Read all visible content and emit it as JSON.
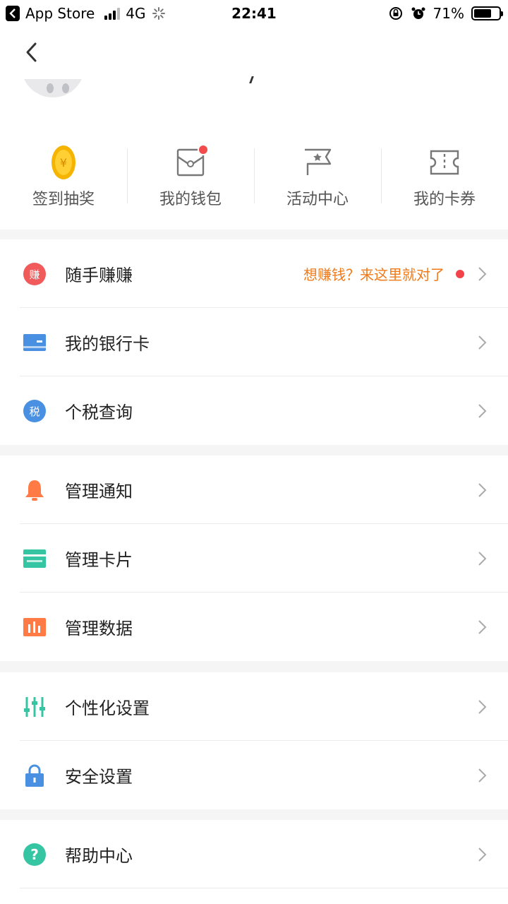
{
  "status_bar": {
    "back_app": "App Store",
    "network": "4G",
    "time": "22:41",
    "battery": "71%",
    "battery_level": 0.71
  },
  "quick_actions": [
    {
      "label": "签到抽奖",
      "icon": "coin-icon",
      "badge": false
    },
    {
      "label": "我的钱包",
      "icon": "wallet-icon",
      "badge": true
    },
    {
      "label": "活动中心",
      "icon": "flag-icon",
      "badge": false
    },
    {
      "label": "我的卡券",
      "icon": "ticket-icon",
      "badge": false
    }
  ],
  "groups": [
    {
      "items": [
        {
          "label": "随手赚赚",
          "icon": "earn-icon",
          "icon_text": "赚",
          "hint": "想赚钱？来这里就对了",
          "color": "#f05a5a"
        },
        {
          "label": "我的银行卡",
          "icon": "bank-card-icon",
          "color": "#4a90e2"
        },
        {
          "label": "个税查询",
          "icon": "tax-icon",
          "icon_text": "税",
          "color": "#4a90e2"
        }
      ]
    },
    {
      "items": [
        {
          "label": "管理通知",
          "icon": "bell-icon",
          "color": "#ff7a45"
        },
        {
          "label": "管理卡片",
          "icon": "cards-icon",
          "color": "#36c5a3"
        },
        {
          "label": "管理数据",
          "icon": "bar-chart-icon",
          "color": "#ff7a45"
        }
      ]
    },
    {
      "items": [
        {
          "label": "个性化设置",
          "icon": "sliders-icon",
          "color": "#36c5a3"
        },
        {
          "label": "安全设置",
          "icon": "lock-icon",
          "color": "#4a90e2"
        }
      ]
    },
    {
      "items": [
        {
          "label": "帮助中心",
          "icon": "help-icon",
          "icon_text": "?",
          "color": "#36c5a3"
        }
      ]
    }
  ],
  "colors": {
    "accent_orange": "#f07a1a",
    "badge_red": "#f24b4b",
    "divider": "#ececec",
    "bg": "#f5f5f5"
  }
}
